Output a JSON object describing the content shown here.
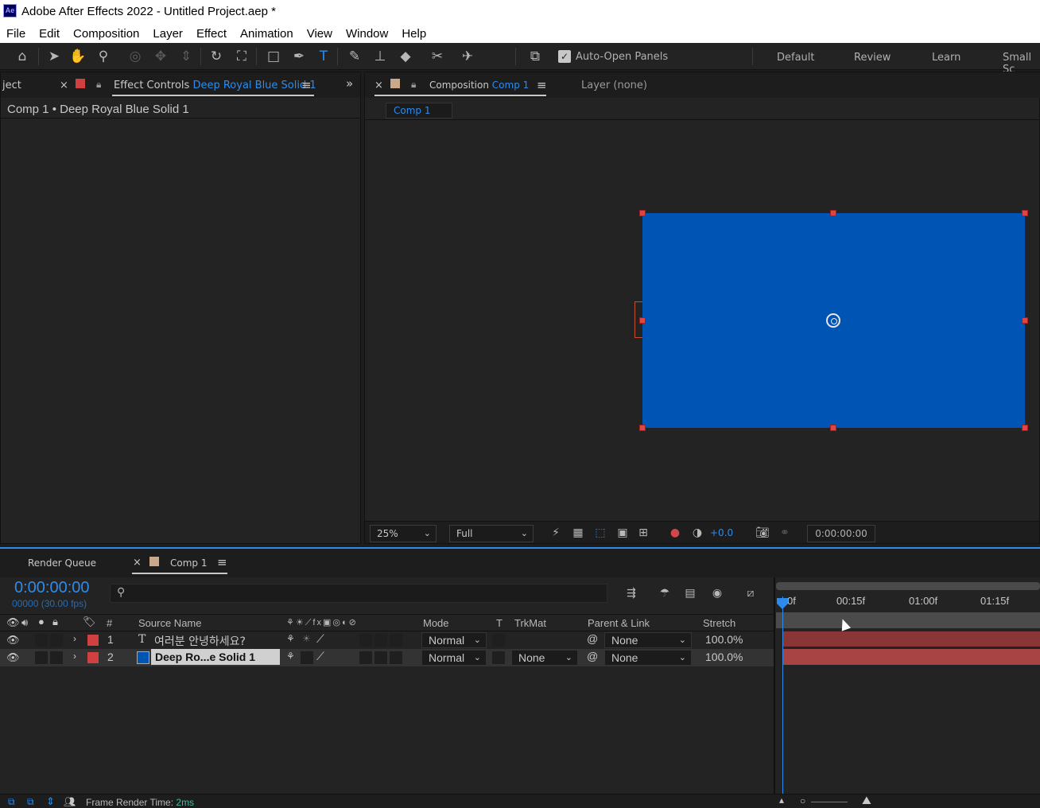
{
  "app": {
    "icon_label": "Ae",
    "window_title": "Adobe After Effects 2022 - Untitled Project.aep *"
  },
  "menu": [
    "File",
    "Edit",
    "Composition",
    "Layer",
    "Effect",
    "Animation",
    "View",
    "Window",
    "Help"
  ],
  "toolbar": {
    "auto_open_label": "Auto-Open Panels",
    "workspaces": [
      "Default",
      "Review",
      "Learn",
      "Small Sc"
    ]
  },
  "effect_controls": {
    "project_tab_fragment": "ject",
    "tab_prefix": "Effect Controls",
    "tab_target": "Deep Royal Blue Solid 1",
    "subtitle": "Comp 1 • Deep Royal Blue Solid 1"
  },
  "composition": {
    "tab_prefix": "Composition",
    "tab_target": "Comp 1",
    "layer_tab": "Layer (none)",
    "crumb": "Comp 1",
    "zoom": "25%",
    "resolution": "Full",
    "exposure": "+0.0",
    "timecode": "0:00:00:00",
    "solid_color": "#0054b4"
  },
  "timeline": {
    "render_queue_tab": "Render Queue",
    "comp_tab": "Comp 1",
    "timecode": "0:00:00:00",
    "frames": "00000 (30.00 fps)",
    "search_placeholder": "",
    "columns": {
      "number": "#",
      "source_name": "Source Name",
      "mode": "Mode",
      "t": "T",
      "trkmat": "TrkMat",
      "parent": "Parent & Link",
      "stretch": "Stretch"
    },
    "ruler_ticks": [
      "0f",
      "00:15f",
      "01:00f",
      "01:15f"
    ],
    "layers": [
      {
        "num": "1",
        "type_glyph": "T",
        "name": "여러분 안녕하세요?",
        "mode": "Normal",
        "trkmat": "",
        "parent": "None",
        "stretch": "100.0%",
        "label_color": "#d04040"
      },
      {
        "num": "2",
        "type_glyph": "",
        "name": "Deep Ro...e Solid 1",
        "mode": "Normal",
        "trkmat": "None",
        "parent": "None",
        "stretch": "100.0%",
        "label_color": "#d04040",
        "swatch_color": "#0054b4"
      }
    ],
    "status_label": "Frame Render Time:",
    "status_value": "2ms"
  }
}
